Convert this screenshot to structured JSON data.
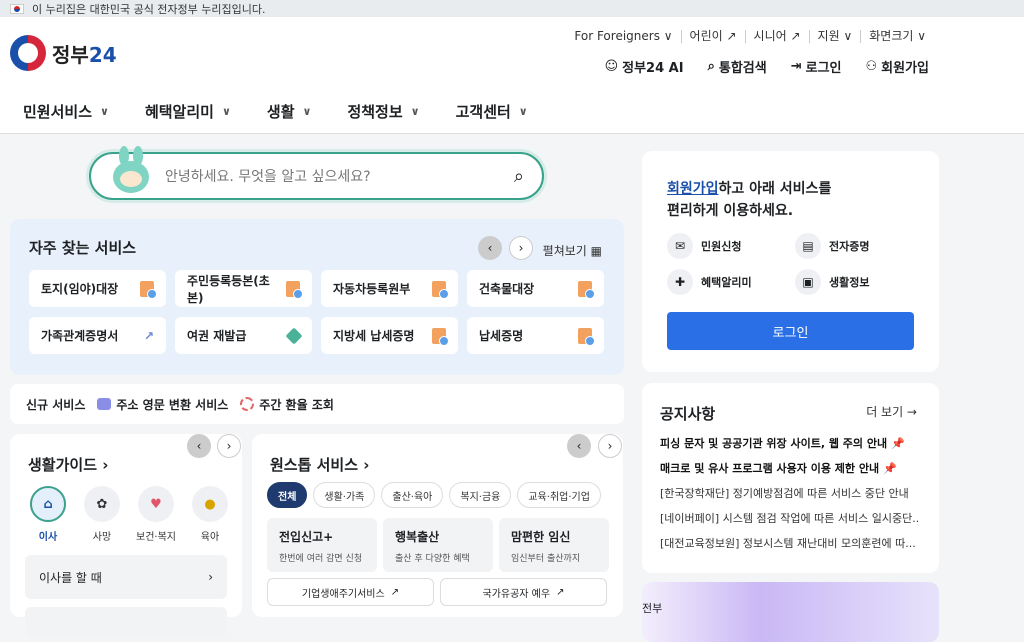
{
  "topbar": {
    "flag_icon": "korea-flag-icon",
    "text": "이 누리집은 대한민국 공식 전자정부 누리집입니다."
  },
  "logo": {
    "text_ko": "정부",
    "text_num": "24"
  },
  "util": [
    "For Foreigners ∨",
    "어린이 ↗",
    "시니어 ↗",
    "지원 ∨",
    "화면크기 ∨"
  ],
  "gnb_right": {
    "ai": "정부24 AI",
    "search": "통합검색",
    "login": "로그인",
    "signup": "회원가입"
  },
  "nav": [
    "민원서비스",
    "혜택알리미",
    "생활",
    "정책정보",
    "고객센터"
  ],
  "search": {
    "placeholder": "안녕하세요. 무엇을 알고 싶으세요?"
  },
  "fav": {
    "title": "자주 찾는 서비스",
    "expand": "펼쳐보기",
    "items": [
      "토지(임야)대장",
      "주민등록등본(초본)",
      "자동차등록원부",
      "건축물대장",
      "가족관계증명서",
      "여권 재발급",
      "지방세 납세증명",
      "납세증명"
    ]
  },
  "newsvc": {
    "label": "신규 서비스",
    "item1": "주소 영문 변환 서비스",
    "item2": "주간 환율 조회"
  },
  "guide": {
    "title": "생활가이드",
    "icons": [
      "이사",
      "사망",
      "보건·복지",
      "육아"
    ],
    "row": "이사를 할 때"
  },
  "onestop": {
    "title": "원스톱 서비스",
    "tabs": [
      "전체",
      "생활·가족",
      "출산·육아",
      "복지·금융",
      "교육·취업·기업"
    ],
    "cards": [
      {
        "t": "전입신고+",
        "d": "한번에 여러 감면 신청"
      },
      {
        "t": "행복출산",
        "d": "출산 후 다양한 혜택"
      },
      {
        "t": "맘편한 임신",
        "d": "임신부터 출산까지"
      }
    ],
    "links": [
      "기업생애주기서비스",
      "국가유공자 예우"
    ]
  },
  "login_card": {
    "msg_link": "회원가입",
    "msg_rest1": "하고 아래 서비스를",
    "msg_rest2": "편리하게 이용하세요.",
    "items": [
      "민원신청",
      "전자증명",
      "혜택알리미",
      "생활정보"
    ],
    "button": "로그인"
  },
  "notice": {
    "title": "공지사항",
    "more": "더 보기 →",
    "items": [
      "피싱 문자 및 공공기관 위장 사이트, 웹 주의 안내",
      "매크로 및 유사 프로그램 사용자 이용 제한 안내",
      "[한국장학재단] 정기예방점검에 따른 서비스 중단 안내",
      "[네이버페이] 시스템 점검 작업에 따른 서비스 일시중단...",
      "[대전교육정보원] 정보시스템 재난대비 모의훈련에 따..."
    ]
  },
  "banner_text": "전부"
}
